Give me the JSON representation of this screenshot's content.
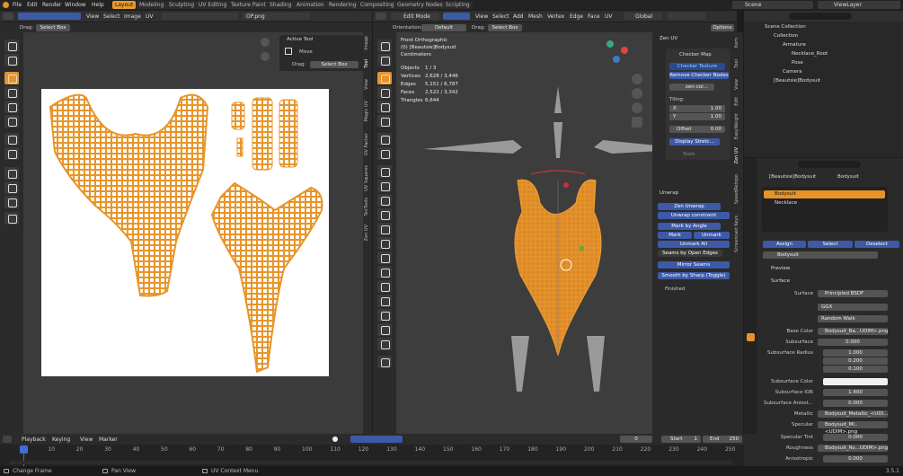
{
  "topbar": {
    "menus": [
      "File",
      "Edit",
      "Render",
      "Window",
      "Help"
    ],
    "workspaces": [
      "Layout",
      "Modeling",
      "Sculpting",
      "UV Editing",
      "Texture Paint",
      "Shading",
      "Animation",
      "Rendering",
      "Compositing",
      "Geometry Nodes",
      "Scripting"
    ],
    "active_workspace": "Layout",
    "scene": "Scene",
    "view_layer": "ViewLayer"
  },
  "uv_editor": {
    "menus": [
      "View",
      "Select",
      "Image",
      "UV"
    ],
    "image_name": "OP.png",
    "drag_label": "Drag:",
    "drag_value": "Select Box",
    "side_tabs": [
      "Image",
      "Tool",
      "View",
      "Magic UV",
      "UV Packer",
      "UV Squares",
      "TexTools",
      "Zen UV"
    ],
    "active_tool": {
      "title": "Active Tool",
      "tool": "Move",
      "drag_label": "Drag:",
      "drag_value": "Select Box"
    }
  },
  "viewport": {
    "mode": "Edit Mode",
    "menus": [
      "View",
      "Select",
      "Add",
      "Mesh",
      "Vertex",
      "Edge",
      "Face",
      "UV"
    ],
    "transform": "Global",
    "options": "Options",
    "orientation_label": "Orientation:",
    "orientation_value": "Default",
    "drag_label": "Drag:",
    "drag_value": "Select Box",
    "view_name": "Front Orthographic",
    "object_name": "(0) [Beautsie]Bodysuit",
    "units": "Centimeters",
    "stats": [
      {
        "label": "Objects",
        "value": "1 / 3"
      },
      {
        "label": "Vertices",
        "value": "2,628 / 3,446"
      },
      {
        "label": "Edges",
        "value": "5,151 / 6,787"
      },
      {
        "label": "Faces",
        "value": "2,522 / 3,342"
      },
      {
        "label": "Triangles",
        "value": "6,644"
      }
    ],
    "side_tabs": [
      "Item",
      "Tool",
      "View",
      "Edit",
      "EasyWeight",
      "Zen UV",
      "SpeedRetopo",
      "Screencast Keys"
    ]
  },
  "zen_uv": {
    "title": "Zen UV",
    "checker_map": "Checker Map",
    "checker_texture": "Checker Texture",
    "remove_checker": "Remove Checker Nodes",
    "image": "zen-col...",
    "tiling": "Tiling:",
    "x_label": "X",
    "x_value": "1.00",
    "y_label": "Y",
    "y_value": "1.00",
    "offset_label": "Offset",
    "offset_value": "0.00",
    "display_stretch": "Display Stretc...",
    "tools": "Tools",
    "unwrap_title": "Unwrap",
    "zen_unwrap": "Zen Unwrap",
    "unwrap_constraint": "Unwrap constraint",
    "mark_by_angle": "Mark by Angle",
    "mark": "Mark",
    "unmark": "Unmark",
    "unmark_all": "Unmark All",
    "seams_by_open_edges": "Seams by Open Edges",
    "mirror_seams": "Mirror Seams",
    "smooth_by_sharp": "Smooth by Sharp (Toggle)",
    "finished": "Finished"
  },
  "outliner": {
    "scene_collection": "Scene Collection",
    "collection": "Collection",
    "armature": "Armature",
    "necklace_root": "Necklace_Root",
    "pose": "Pose",
    "camera": "Camera",
    "bodysuit": "[Beautsie]Bodysuit"
  },
  "properties": {
    "object_path": "[Beautsie]Bodysuit",
    "mesh_name": "Bodysuit",
    "materials": [
      "Bodysuit",
      "Necklace"
    ],
    "assign": "Assign",
    "select": "Select",
    "deselect": "Deselect",
    "material_name": "Bodysuit",
    "preview": "Preview",
    "surface_header": "Surface",
    "surface_label": "Surface",
    "surface_value": "Principled BSDF",
    "distribution": "GGX",
    "subsurface_method": "Random Walk",
    "rows": [
      {
        "label": "Base Color",
        "value": "Bodysuit_Ba...UDIM>.png"
      },
      {
        "label": "Subsurface",
        "value": "0.000"
      },
      {
        "label": "Subsurface Radius",
        "value": "1.000"
      },
      {
        "label": "",
        "value": "0.200"
      },
      {
        "label": "",
        "value": "0.100"
      },
      {
        "label": "Subsurface Color",
        "value": ""
      },
      {
        "label": "Subsurface IOR",
        "value": "1.400"
      },
      {
        "label": "Subsurface Anisot...",
        "value": "0.000"
      },
      {
        "label": "Metallic",
        "value": "Bodysuit_Metallic_<UDI..."
      },
      {
        "label": "Specular",
        "value": "Bodysuit_Mi..<UDIM>.png"
      },
      {
        "label": "Specular Tint",
        "value": "0.000"
      },
      {
        "label": "Roughness",
        "value": "Bodysuit_Ro...UDIM>.png"
      },
      {
        "label": "Anisotropic",
        "value": "0.000"
      }
    ]
  },
  "timeline": {
    "menus": [
      "Playback",
      "Keying",
      "View",
      "Marker"
    ],
    "current_frame": "0",
    "start_label": "Start",
    "start": "1",
    "end_label": "End",
    "end": "250",
    "ticks": [
      "0",
      "10",
      "20",
      "30",
      "40",
      "50",
      "60",
      "70",
      "80",
      "90",
      "100",
      "110",
      "120",
      "130",
      "140",
      "150",
      "160",
      "170",
      "180",
      "190",
      "200",
      "210",
      "220",
      "230",
      "240",
      "250"
    ]
  },
  "status": {
    "left": "Change Frame",
    "middle": "Pan View",
    "right": "UV Context Menu",
    "version": "3.5.1"
  },
  "colors": {
    "accent": "#e8932a",
    "button_blue": "#3d5aa8",
    "mesh_orange": "#e8952a"
  }
}
